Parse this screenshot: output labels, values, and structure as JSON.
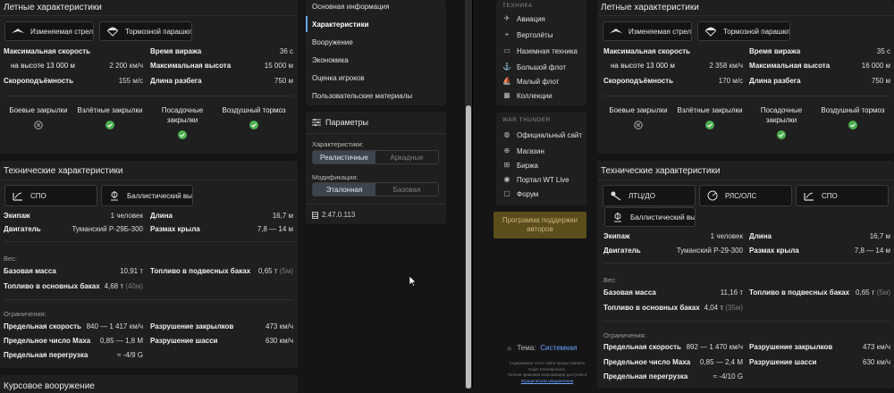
{
  "left": {
    "flight": {
      "title": "Летные характеристики",
      "chip1": "Изменяемая стрел...",
      "chip2": "Тормозной парашют",
      "rows": [
        {
          "k1": "Максимальная скорость",
          "v1": "",
          "k2": "Время виража",
          "v2": "36 с"
        },
        {
          "k1": "на высоте 13 000 м",
          "v1": "2 200 км/ч",
          "k2": "Максимальная высота",
          "v2": "15 000 м"
        },
        {
          "k1": "Скороподъёмность",
          "v1": "155 м/с",
          "k2": "Длина разбега",
          "v2": "750 м"
        }
      ],
      "flaps": [
        "Боевые закрылки",
        "Взлётные закрылки",
        "Посадочные закрылки",
        "Воздушный тормоз"
      ]
    },
    "tech": {
      "title": "Технические характеристики",
      "chip1": "СПО",
      "chip2": "Баллистический вы...",
      "crew_k": "Экипаж",
      "crew_v": "1 человек",
      "len_k": "Длина",
      "len_v": "16,7 м",
      "eng_k": "Двигатель",
      "eng_v": "Туманский Р-29Б-300",
      "wing_k": "Размах крыла",
      "wing_v": "7,8 — 14 м",
      "weight_hdr": "Вес:",
      "base_k": "Базовая масса",
      "base_v": "10,91 т",
      "pods_k": "Топливо в подвесных баках",
      "pods_v": "0,65 т",
      "pods_d": "(5м)",
      "fuel_k": "Топливо в основных баках",
      "fuel_v": "4,68 т",
      "fuel_d": "(40м)",
      "lim_hdr": "Ограничения:",
      "spd_k": "Предельная скорость",
      "spd_v": "840 — 1 417 км/ч",
      "flapd_k": "Разрушение закрылков",
      "flapd_v": "473 км/ч",
      "mach_k": "Предельное число Маха",
      "mach_v": "0,85 — 1,8 М",
      "gear_k": "Разрушение шасси",
      "gear_v": "630 км/ч",
      "g_k": "Предельная перегрузка",
      "g_v": "≈ -4/9 G"
    },
    "next_title": "Курсовое вооружение"
  },
  "middle": {
    "menu": [
      "Основная информация",
      "Характеристики",
      "Вооружение",
      "Экономика",
      "Оценка игроков",
      "Пользовательские материалы"
    ],
    "params_title": "Параметры",
    "char_label": "Характеристики:",
    "char_opts": [
      "Реалистичные",
      "Аркадные"
    ],
    "mod_label": "Модификация:",
    "mod_opts": [
      "Эталонная",
      "Базовая"
    ],
    "version": "2.47.0.113"
  },
  "nav": {
    "tech_hdr": "ТЕХНИКА",
    "tech_items": [
      "Авиация",
      "Вертолёты",
      "Наземная техника",
      "Большой флот",
      "Малый флот",
      "Коллекции"
    ],
    "wt_hdr": "WAR THUNDER",
    "wt_items": [
      "Официальный сайт",
      "Магазин",
      "Биржа",
      "Портал WT Live",
      "Форум"
    ],
    "support": "Программа поддержки авторов",
    "theme_label": "Тема:",
    "theme_value": "Системная",
    "foot1": "Содержимое этого сайта предоставлено",
    "foot2": "Gaijin Entertainment.",
    "foot3": "Полная правовая информация доступна в",
    "foot4": "Юридическом уведомлении"
  },
  "right": {
    "flight": {
      "title": "Летные характеристики",
      "chip1": "Изменяемая стрел...",
      "chip2": "Тормозной парашют",
      "rows": [
        {
          "k1": "Максимальная скорость",
          "v1": "",
          "k2": "Время виража",
          "v2": "35 с"
        },
        {
          "k1": "на высоте 13 000 м",
          "v1": "2 358 км/ч",
          "k2": "Максимальная высота",
          "v2": "16 000 м"
        },
        {
          "k1": "Скороподъёмность",
          "v1": "170 м/с",
          "k2": "Длина разбега",
          "v2": "750 м"
        }
      ],
      "flaps": [
        "Боевые закрылки",
        "Взлётные закрылки",
        "Посадочные закрылки",
        "Воздушный тормоз"
      ]
    },
    "tech": {
      "title": "Технические характеристики",
      "chip1": "ЛТЦ/ДО",
      "chip2": "РЛС/ОЛС",
      "chip3": "СПО",
      "chip4": "Баллистический вы...",
      "crew_k": "Экипаж",
      "crew_v": "1 человек",
      "len_k": "Длина",
      "len_v": "16,7 м",
      "eng_k": "Двигатель",
      "eng_v": "Туманский Р-29-300",
      "wing_k": "Размах крыла",
      "wing_v": "7,8 — 14 м",
      "weight_hdr": "Вес:",
      "base_k": "Базовая масса",
      "base_v": "11,16 т",
      "pods_k": "Топливо в подвесных баках",
      "pods_v": "0,65 т",
      "pods_d": "(5м)",
      "fuel_k": "Топливо в основных баках",
      "fuel_v": "4,04 т",
      "fuel_d": "(35м)",
      "lim_hdr": "Ограничения:",
      "spd_k": "Предельная скорость",
      "spd_v": "892 — 1 470 км/ч",
      "flapd_k": "Разрушение закрылков",
      "flapd_v": "473 км/ч",
      "mach_k": "Предельное число Маха",
      "mach_v": "0,85 — 2,4 М",
      "gear_k": "Разрушение шасси",
      "gear_v": "630 км/ч",
      "g_k": "Предельная перегрузка",
      "g_v": "≈ -4/10 G"
    }
  },
  "colors": {
    "check": "#4caf50",
    "segment_on": "#3c4450",
    "link": "#6aa3ff",
    "support_bg": "#5b4d1c"
  }
}
